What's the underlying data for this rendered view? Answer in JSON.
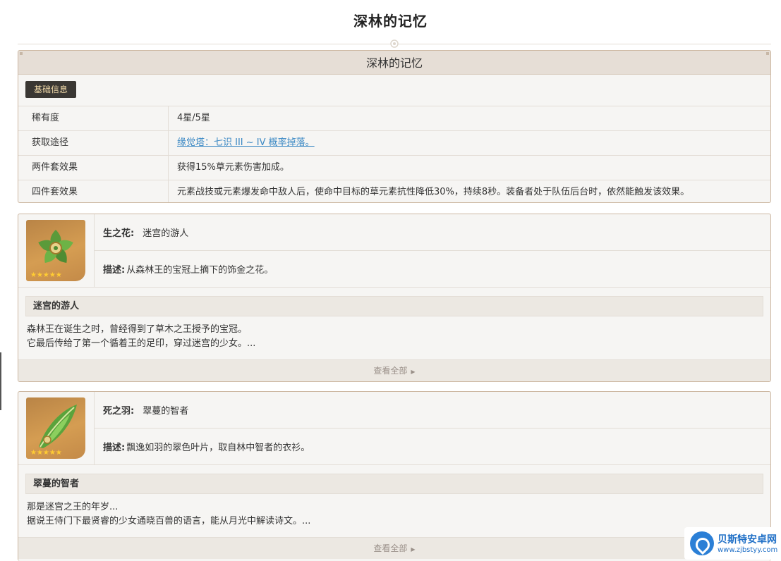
{
  "page_title": "深林的记忆",
  "info": {
    "header": "深林的记忆",
    "tag": "基础信息",
    "rows": [
      {
        "key": "稀有度",
        "value": "4星/5星"
      },
      {
        "key": "获取途径",
        "value": "缘觉塔：七识 III ~ IV 概率掉落。"
      },
      {
        "key": "两件套效果",
        "value": "获得15%草元素伤害加成。"
      },
      {
        "key": "四件套效果",
        "value": "元素战技或元素爆发命中敌人后，使命中目标的草元素抗性降低30%，持续8秒。装备者处于队伍后台时，依然能触发该效果。"
      }
    ]
  },
  "cards": [
    {
      "icon": "flower-of-life-icon",
      "slot_label": "生之花:",
      "name": "迷宫的游人",
      "desc_label": "描述:",
      "desc": "从森林王的宝冠上摘下的饰金之花。",
      "section_title": "迷宫的游人",
      "story_lines": [
        "森林王在诞生之时，曾经得到了草木之王授予的宝冠。",
        "它最后传给了第一个循着王的足印，穿过迷宫的少女。..."
      ],
      "stars": "★★★★★",
      "view_all": "查看全部"
    },
    {
      "icon": "plume-of-death-icon",
      "slot_label": "死之羽:",
      "name": "翠蔓的智者",
      "desc_label": "描述:",
      "desc": "飘逸如羽的翠色叶片，取自林中智者的衣衫。",
      "section_title": "翠蔓的智者",
      "story_lines": [
        "那是迷宫之王的年岁...",
        "据说王侍门下最贤睿的少女通晓百兽的语言，能从月光中解读诗文。..."
      ],
      "stars": "★★★★★",
      "view_all": "查看全部"
    }
  ],
  "watermark": {
    "title": "贝斯特安卓网",
    "url": "www.zjbstyy.com"
  },
  "colors": {
    "accent_border": "#cdb8a2",
    "header_bg": "#e6ded6",
    "tag_bg": "#3a3733",
    "link": "#3a88c4",
    "star": "#ffcc33"
  }
}
